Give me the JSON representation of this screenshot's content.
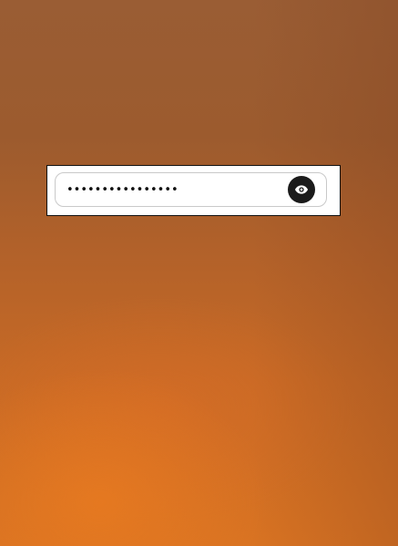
{
  "password_field": {
    "value": "••••••••••••••••",
    "type": "password",
    "toggle_icon": "eye-icon",
    "toggle_color": "#1b1b1b"
  },
  "colors": {
    "background_top": "#9a5d34",
    "background_bottom": "#d97322",
    "card": "#ffffff"
  }
}
